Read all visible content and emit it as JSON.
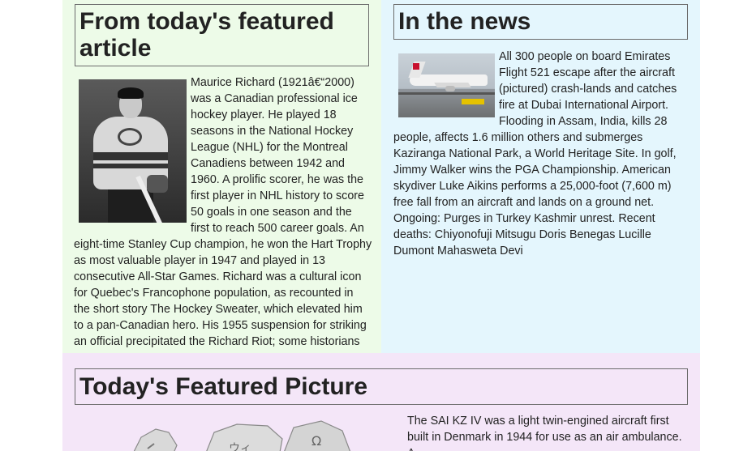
{
  "featured_article": {
    "heading": "From today's featured article",
    "image_alt": "Maurice Richard hockey photo",
    "body": "Maurice Richard (1921â€“2000) was a Canadian professional ice hockey player. He played 18 seasons in the National Hockey League (NHL) for the Montreal Canadiens between 1942 and 1960. A prolific scorer, he was the first player in NHL history to score 50 goals in one season and the first to reach 500 career goals. An eight-time Stanley Cup champion, he won the Hart Trophy as most valuable player in 1947 and played in 13 consecutive All-Star Games. Richard was a cultural icon for Quebec's Francophone population, as recounted in the short story The Hockey Sweater, which elevated him to a pan-Canadian hero. His 1955 suspension for striking an official precipitated the Richard Riot; some historians"
  },
  "in_the_news": {
    "heading": "In the news",
    "image_alt": "Emirates aircraft at Dubai International Airport",
    "body": "All 300 people on board Emirates Flight 521 escape after the aircraft (pictured) crash-lands and catches fire at Dubai International Airport. Flooding in Assam, India, kills 28 people, affects 1.6 million others and submerges Kaziranga National Park, a World Heritage Site. In golf, Jimmy Walker wins the PGA Championship. American skydiver Luke Aikins performs a 25,000-foot (7,600 m) free fall from an aircraft and lands on a ground net. Ongoing: Purges in Turkey Kashmir unrest. Recent deaths: Chiyonofuji Mitsugu Doris Benegas Lucille Dumont Mahasweta Devi"
  },
  "featured_picture": {
    "heading": "Today's Featured Picture",
    "body": "The SAI KZ IV was a light twin-engined aircraft first built in Denmark in 1944 for use as an air ambulance. A"
  },
  "colors": {
    "featured_bg": "#edfbe8",
    "news_bg": "#e4f6fd",
    "picture_bg": "#f4e6f8",
    "heading_border": "#6b6b6b"
  }
}
